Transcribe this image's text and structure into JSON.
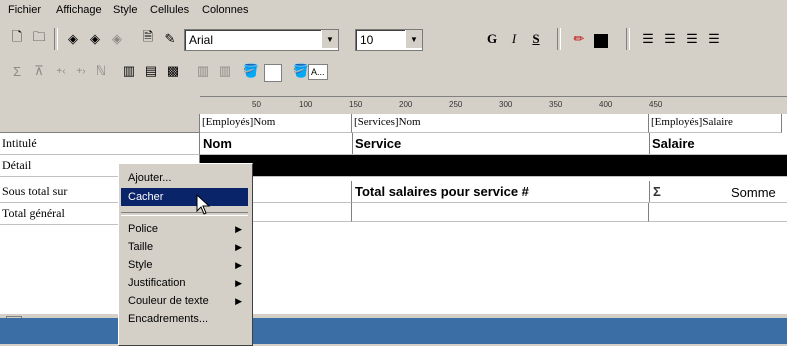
{
  "menubar": [
    "Fichier",
    "Affichage",
    "Style",
    "Cellules",
    "Colonnes"
  ],
  "toolbar": {
    "font": "Arial",
    "size": "10",
    "bold_label": "G",
    "italic_label": "I",
    "underline_label": "S",
    "text_button_label": "A..."
  },
  "ruler": [
    "50",
    "100",
    "150",
    "200",
    "250",
    "300",
    "350",
    "400",
    "450"
  ],
  "columns": [
    "[Employés]Nom",
    "[Services]Nom",
    "[Employés]Salaire"
  ],
  "rows": {
    "intitule": {
      "label": "Intitulé",
      "c1": "Nom",
      "c2": "Service",
      "c3": "Salaire"
    },
    "detail": {
      "label": "Détail"
    },
    "sous_total": {
      "label": "Sous total sur",
      "c2": "Total salaires pour service #",
      "c3_sigma": "Σ",
      "c3": "Somme"
    },
    "total_general": {
      "label": "Total général"
    }
  },
  "context_menu": {
    "items": [
      "Ajouter...",
      "Cacher"
    ],
    "submenus": [
      "Police",
      "Taille",
      "Style",
      "Justification",
      "Couleur de texte"
    ],
    "last": "Encadrements..."
  }
}
